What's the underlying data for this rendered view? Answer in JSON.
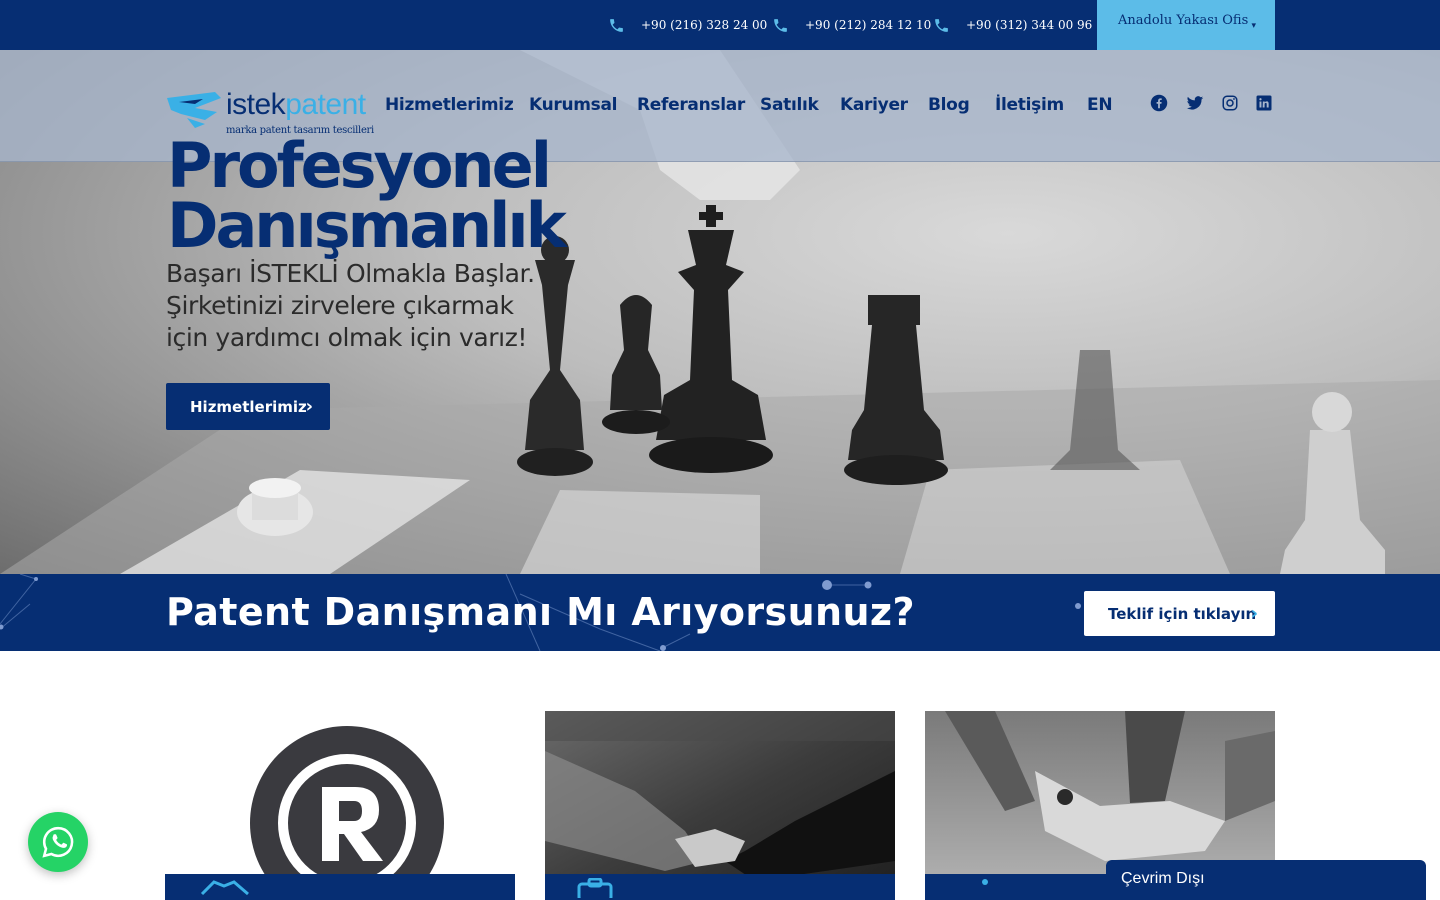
{
  "topbar": {
    "phones": [
      {
        "number": "+90 (216) 328 24 00",
        "icon": "phone-icon"
      },
      {
        "number": "+90 (212) 284 12 10",
        "icon": "phone-icon"
      },
      {
        "number": "+90 (312) 344 00 96",
        "icon": "phone-icon"
      }
    ],
    "office_select": {
      "value": "Anadolu Yakası Ofis",
      "caret": "▾"
    }
  },
  "logo": {
    "word1": "istek",
    "word2": "patent",
    "tagline": "marka patent tasarım tescilleri"
  },
  "nav": {
    "items": [
      "Hizmetlerimiz",
      "Kurumsal",
      "Referanslar",
      "Satılık",
      "Kariyer",
      "Blog",
      "İletişim",
      "EN"
    ],
    "social": [
      "facebook-icon",
      "twitter-icon",
      "instagram-icon",
      "linkedin-icon"
    ]
  },
  "hero": {
    "title_line1": "Profesyonel",
    "title_line2": "Danışmanlık",
    "subtitle": "Başarı İSTEKLİ Olmakla Başlar. Şirketinizi zirvelere çıkarmak için yardımcı olmak için varız!",
    "button_label": "Hizmetlerimiz",
    "button_icon": "chevron-right-icon"
  },
  "cta": {
    "title": "Patent Danışmanı Mı Arıyorsunuz?",
    "button_label": "Teklif için tıklayın",
    "button_icon": "chevron-right-icon"
  },
  "cards": [
    {
      "image": "registered-trademark-image",
      "icon": "handshake-icon"
    },
    {
      "image": "business-handshake-image",
      "icon": "briefcase-icon"
    },
    {
      "image": "team-hands-image",
      "icon": "people-icon"
    }
  ],
  "widgets": {
    "whatsapp_icon": "whatsapp-icon",
    "chat_status": "Çevrim Dışı"
  },
  "colors": {
    "navy": "#062e73",
    "light_blue": "#5cbce8",
    "accent_blue": "#3ab0e6",
    "whatsapp_green": "#25d366"
  }
}
